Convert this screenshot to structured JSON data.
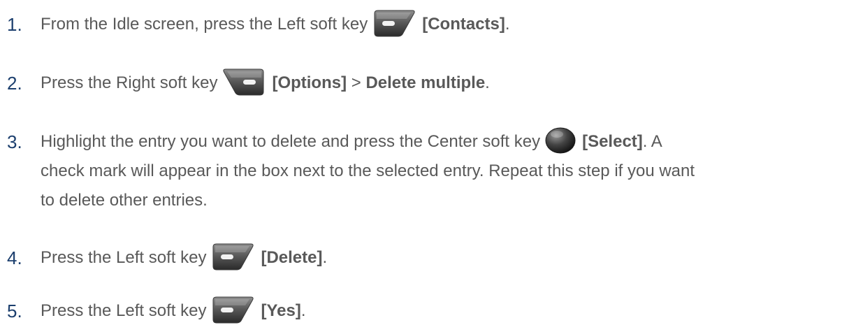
{
  "steps": [
    {
      "number": "1.",
      "before": "From the Idle screen, press the Left soft key",
      "key_icon": "left-soft-key-icon",
      "key_label": "[Contacts]",
      "after": "."
    },
    {
      "number": "2.",
      "before": "Press the Right soft key",
      "key_icon": "right-soft-key-icon",
      "key_label": "[Options]",
      "separator": ">",
      "menu_item": "Delete multiple",
      "after": "."
    },
    {
      "number": "3.",
      "before": "Highlight the entry you want to delete and press the Center soft key",
      "key_icon": "center-soft-key-icon",
      "key_label": "[Select]",
      "after_line1": ". A",
      "line2": "check mark will appear in the box next to the selected entry. Repeat this step if you want",
      "line3": "to delete other entries."
    },
    {
      "number": "4.",
      "before": "Press the Left soft key",
      "key_icon": "left-soft-key-icon",
      "key_label": "[Delete]",
      "after": "."
    },
    {
      "number": "5.",
      "before": "Press the Left soft key",
      "key_icon": "left-soft-key-icon",
      "key_label": "[Yes]",
      "after": "."
    }
  ]
}
